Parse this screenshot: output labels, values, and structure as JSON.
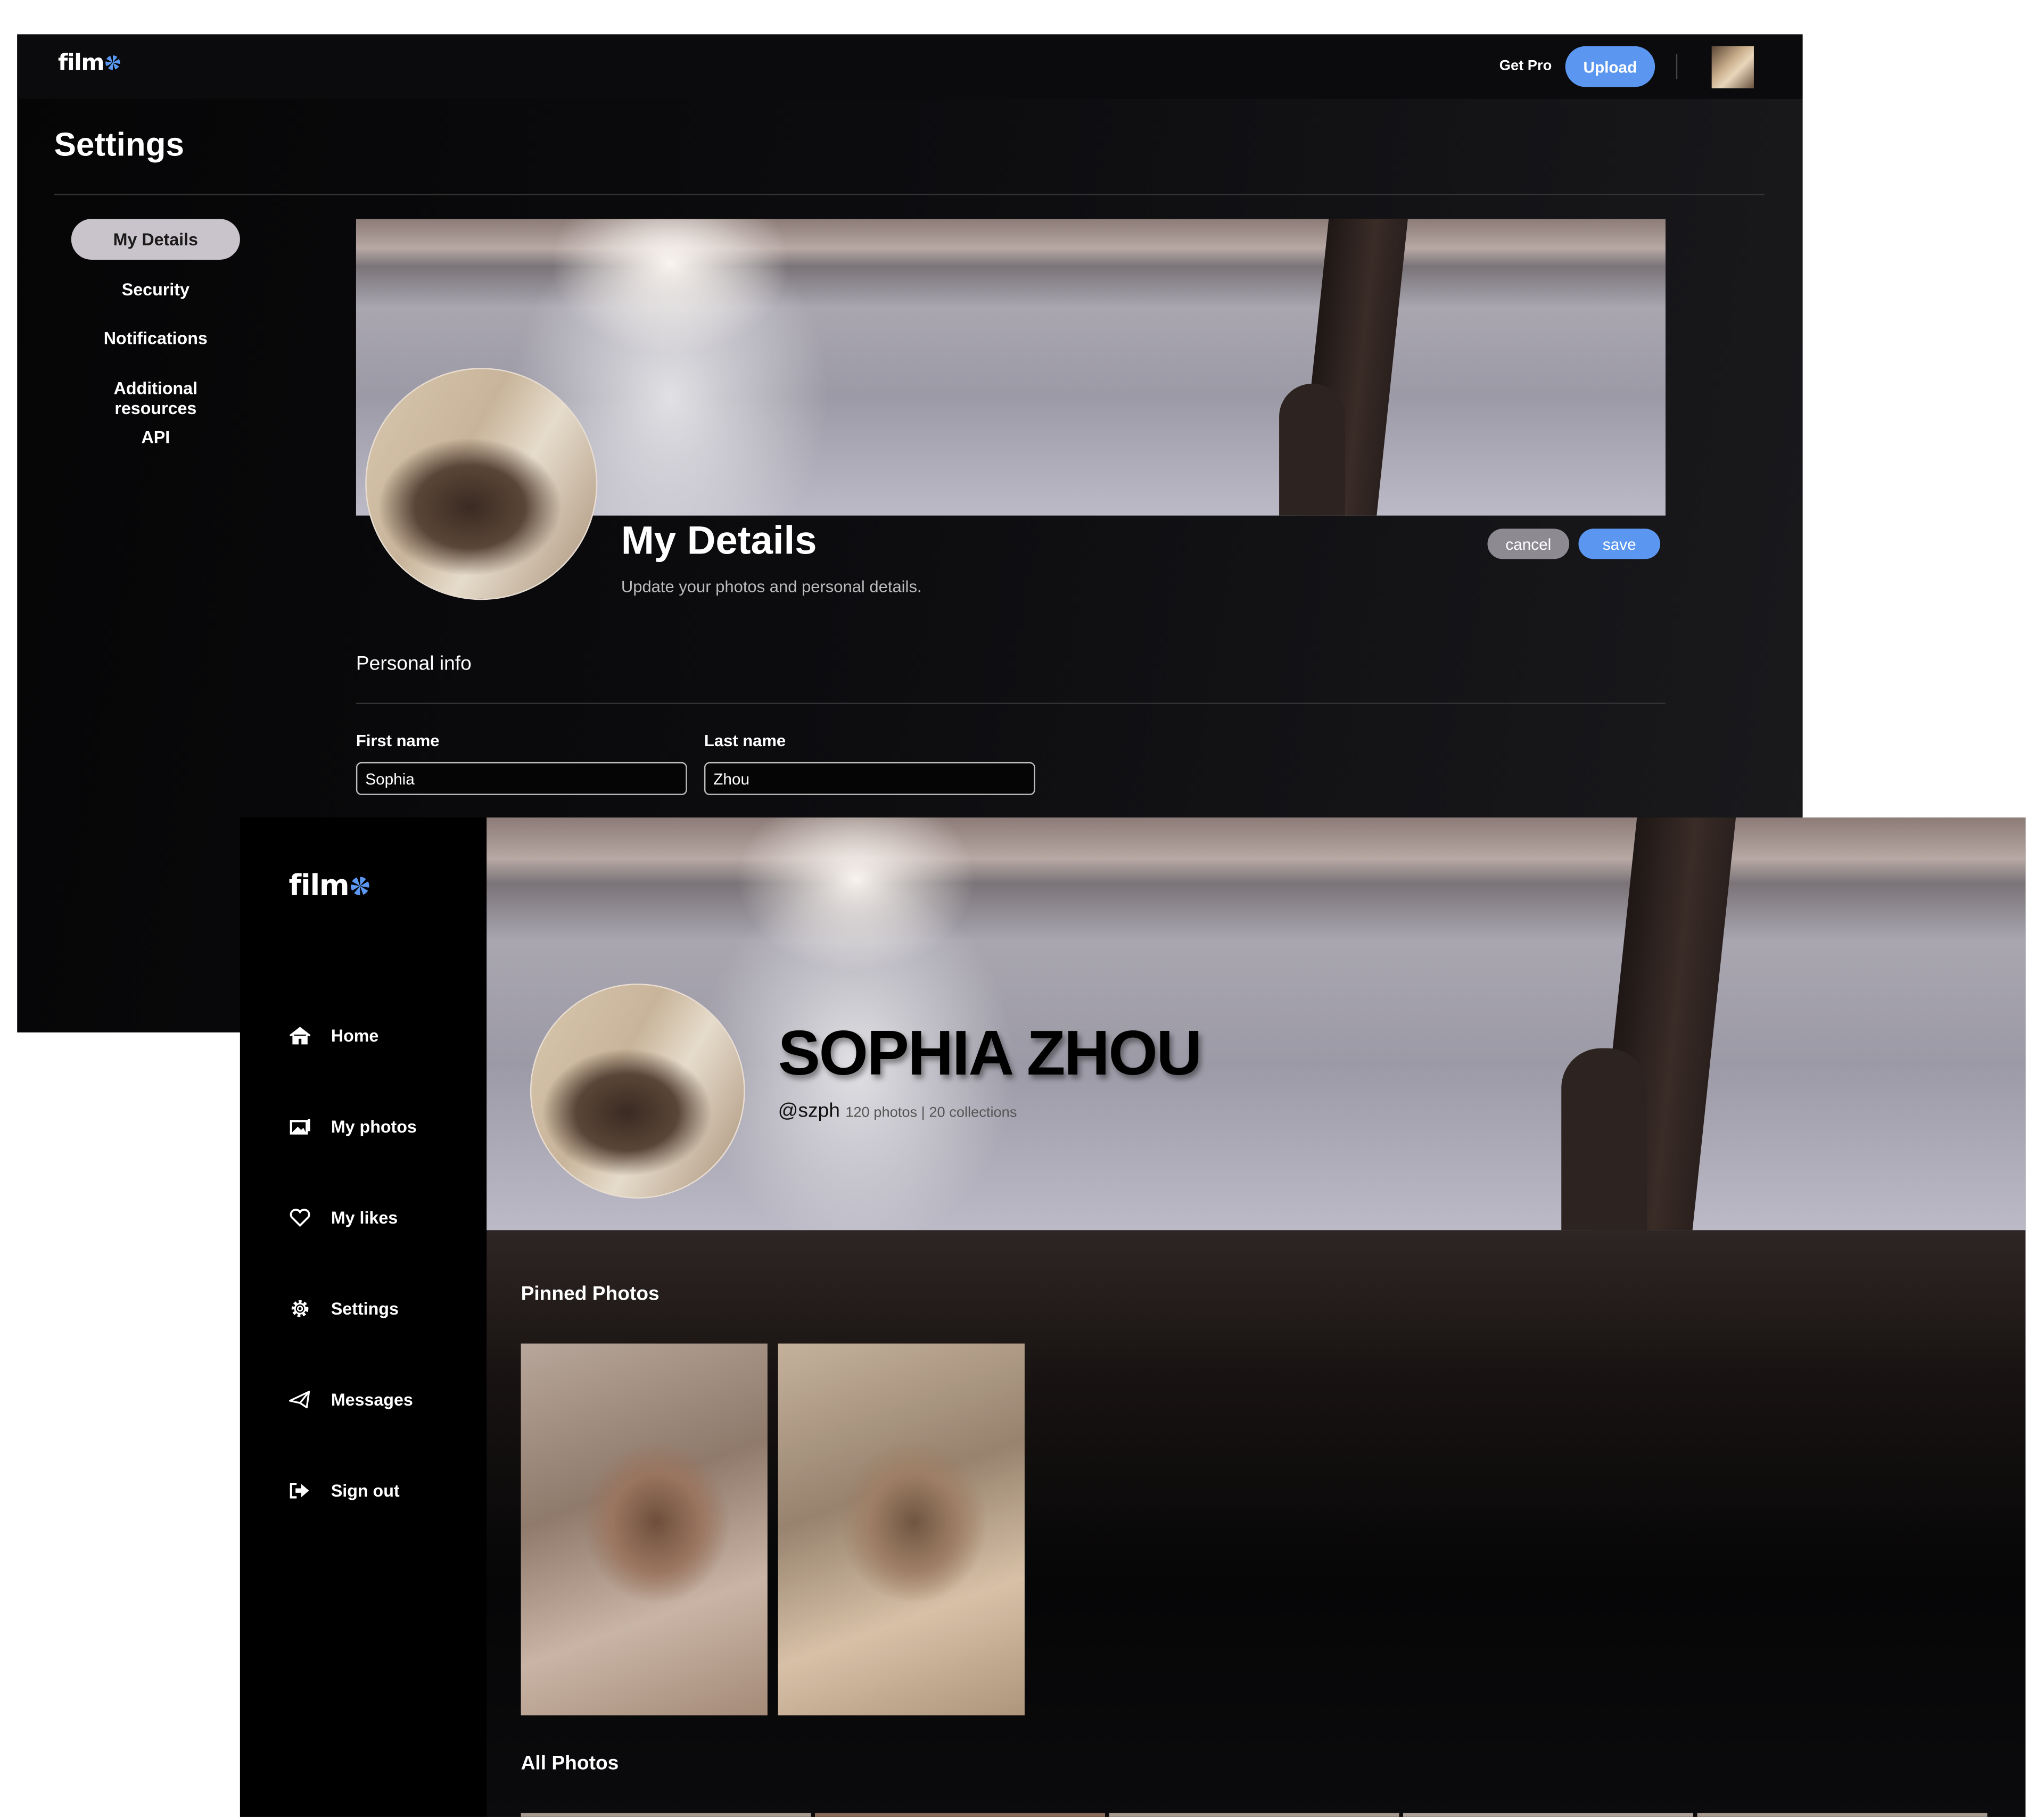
{
  "settings_window": {
    "logo": "film",
    "topbar": {
      "get_pro": "Get Pro",
      "upload": "Upload"
    },
    "title": "Settings",
    "nav": [
      {
        "label": "My Details",
        "active": true
      },
      {
        "label": "Security"
      },
      {
        "label": "Notifications"
      },
      {
        "label": "Additional resources"
      },
      {
        "label": "API"
      }
    ],
    "heading": "My Details",
    "subtitle": "Update your photos and personal details.",
    "cancel": "cancel",
    "save": "save",
    "section": "Personal info",
    "first_name": {
      "label": "First name",
      "value": "Sophia"
    },
    "last_name": {
      "label": "Last name",
      "value": "Zhou"
    }
  },
  "profile_window": {
    "logo": "film",
    "nav": [
      {
        "label": "Home",
        "icon": "home-icon"
      },
      {
        "label": "My photos",
        "icon": "photos-icon"
      },
      {
        "label": "My likes",
        "icon": "heart-icon"
      },
      {
        "label": "Settings",
        "icon": "gear-icon"
      },
      {
        "label": "Messages",
        "icon": "paper-plane-icon"
      },
      {
        "label": "Sign out",
        "icon": "sign-out-icon"
      }
    ],
    "name": "SOPHIA ZHOU",
    "handle": "@szph",
    "stats": "120 photos | 20 collections",
    "pinned_title": "Pinned Photos",
    "all_title": "All Photos"
  },
  "colors": {
    "accent": "#5b97f0",
    "cancel": "#8e8a92",
    "active_nav": "#c9c3cc"
  }
}
